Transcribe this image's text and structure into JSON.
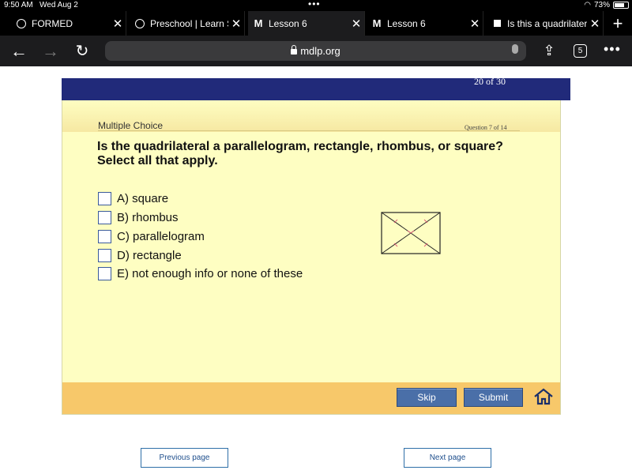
{
  "status_bar": {
    "time": "9:50 AM",
    "date": "Wed Aug 2",
    "dots": "•••",
    "battery": "73%",
    "battery_level": 0.73
  },
  "tabs": [
    {
      "label": "FORMED",
      "icon": "globe-icon",
      "active": false
    },
    {
      "label": "Preschool | Learn Sp",
      "icon": "globe-icon",
      "active": false
    },
    {
      "label": "Lesson 6",
      "icon": "m-logo-icon",
      "active": true
    },
    {
      "label": "Lesson 6",
      "icon": "m-logo-icon",
      "active": false
    },
    {
      "label": "Is this a quadrilatera",
      "icon": "brainly-icon",
      "active": false
    }
  ],
  "tab_close_glyph": "✕",
  "toolbar": {
    "url": "mdlp.org",
    "tab_count": "5",
    "more": "•••"
  },
  "quiz": {
    "progress": "20 of 30",
    "type_label": "Multiple Choice",
    "question_number": "Question 7 of 14",
    "question_line1": "Is the quadrilateral a parallelogram, rectangle, rhombus, or square?",
    "question_line2": "Select all that apply.",
    "options": [
      "A) square",
      "B) rhombus",
      "C) parallelogram",
      "D) rectangle",
      "E) not enough info or none of these"
    ],
    "skip_label": "Skip",
    "submit_label": "Submit"
  },
  "pager": {
    "previous": "Previous page",
    "next": "Next page"
  },
  "colors": {
    "navy": "#212a7a",
    "card": "#fefec2",
    "footer": "#f7c86a",
    "button": "#4a6fa8",
    "figure_marks": "#e0607a"
  }
}
